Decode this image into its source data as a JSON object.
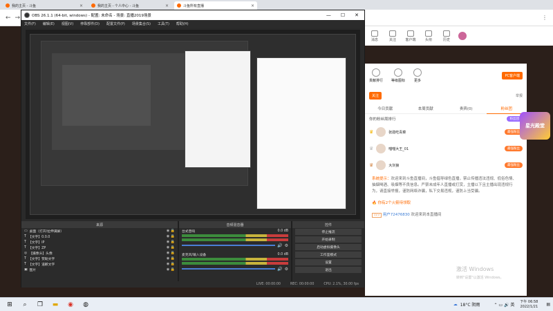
{
  "browser": {
    "tabs": [
      {
        "label": "我的主页 - 斗鱼",
        "active": false
      },
      {
        "label": "我的主页 - 个人中心 - 斗鱼",
        "active": false
      },
      {
        "label": "斗鱼所有直播",
        "active": true
      }
    ]
  },
  "site": {
    "header_icons": [
      "消息",
      "关注",
      "客户端",
      "头衔",
      "历史"
    ],
    "pc_button": "PC客户端",
    "panel_icons": [
      "贡献排行",
      "等级图标",
      "更多"
    ],
    "follow_btn": "关注",
    "report_btn": "举报",
    "tabs": [
      "今日贡献",
      "本周贡献",
      "贵宾(0)",
      "粉丝团"
    ],
    "fans_link": "粉丝团",
    "rank_title": "你的粉丝周排行",
    "ranks": [
      {
        "name": "张勋吃青菜",
        "tag": "最强粉丝"
      },
      {
        "name": "喵喵大王_01",
        "tag": "最强粉丝"
      },
      {
        "name": "大灰狼",
        "tag": "最强粉丝"
      }
    ],
    "system_label": "系统提示：",
    "system_msg": "欢迎来到斗鱼直播间，斗鱼倡导绿色直播，禁止传播违法违规、低俗色情、抽烟喝酒、吸烟等不良信息。严禁未成年人直播或打赏，主播以下且主播出现违规行为，请直接举报，谨防网络诈骗，私下交易违规，谨防上当受骗。",
    "fire_msg": "你有2个火箭待领取",
    "welcome_msg": "欢迎来到本直播间",
    "level_badge": "LV3",
    "user_id": "用户72476830",
    "watermark": "星光殿堂"
  },
  "obs": {
    "title": "OBS 26.1.1 (64-bit, windows) - 配置: 未命名 - 场景: 直播2019场景",
    "menu": [
      "文件(F)",
      "编辑(E)",
      "视图(V)",
      "停靠部件(D)",
      "配置文件(P)",
      "场景集合(S)",
      "工具(T)",
      "帮助(H)"
    ],
    "docks": {
      "sources_title": "来源",
      "mixer_title": "音频混音器",
      "controls_title": "控件"
    },
    "sources": [
      "桌面（打开/拉伸满屏）",
      "【文字】0.0.0",
      "【文字】IP",
      "【文字】ZP",
      "【摄像头】头像",
      "【文字】赞助文字",
      "【文字】道歉文字",
      "图片"
    ],
    "mixer": [
      {
        "name": "台式音响",
        "db": "0.0 dB"
      },
      {
        "name": "麦克风/输入设备",
        "db": "0.0 dB"
      }
    ],
    "controls": [
      "停止推流",
      "开始录制",
      "启动虚拟摄像头",
      "工作室模式",
      "设置",
      "退出"
    ],
    "status": {
      "live": "LIVE: 00:00:00",
      "rec": "REC: 00:00:00",
      "cpu": "CPU: 2.1%, 30.00 fps"
    }
  },
  "taskbar": {
    "weather": "18°C 阴雨",
    "time": "下午 06:58",
    "date": "2022/1/21",
    "activate_line1": "激活 Windows",
    "activate_line2": "转到\"设置\"以激活 Windows。"
  }
}
